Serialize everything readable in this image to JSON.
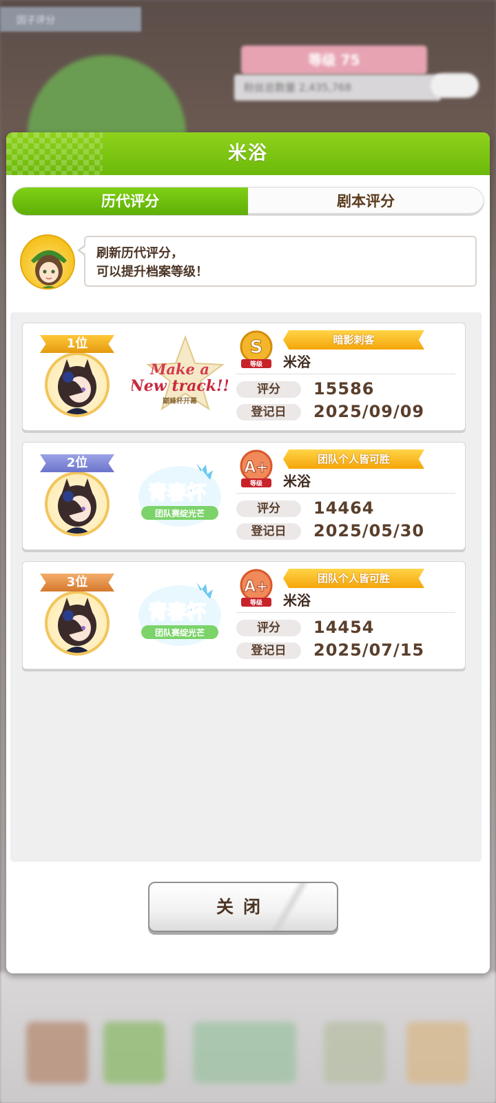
{
  "background": {
    "top_label": "因子评分",
    "level_text": "等级 75",
    "fans_text": "粉丝总数量 2,435,768"
  },
  "dialog": {
    "title": "米浴",
    "tabs": [
      {
        "label": "历代评分",
        "active": true
      },
      {
        "label": "剧本评分",
        "active": false
      }
    ],
    "hint_line1": "刷新历代评分，",
    "hint_line2": "可以提升档案等级！",
    "records": [
      {
        "rank": "1位",
        "grade": "S",
        "grade_sub": "等级",
        "title": "暗影刺客",
        "name": "米浴",
        "score_label": "评分",
        "score": "15586",
        "date_label": "登记日",
        "date": "2025/09/09",
        "scenario_line1": "Make a",
        "scenario_line2": "New track!!",
        "scenario_sub": "巅峰杯开幕"
      },
      {
        "rank": "2位",
        "grade": "A+",
        "grade_sub": "等级",
        "title": "团队个人皆可胜",
        "name": "米浴",
        "score_label": "评分",
        "score": "14464",
        "date_label": "登记日",
        "date": "2025/05/30",
        "scenario_line1": "青春杯",
        "scenario_sub": "团队赛绽光芒"
      },
      {
        "rank": "3位",
        "grade": "A+",
        "grade_sub": "等级",
        "title": "团队个人皆可胜",
        "name": "米浴",
        "score_label": "评分",
        "score": "14454",
        "date_label": "登记日",
        "date": "2025/07/15",
        "scenario_line1": "青春杯",
        "scenario_sub": "团队赛绽光芒"
      }
    ],
    "close_label": "关闭"
  },
  "colors": {
    "header_green": "#7cc815",
    "tab_active": "#6cbd0d",
    "rank1": "#f2b21f",
    "rank2": "#8089d6",
    "rank3": "#e58f45",
    "title_banner": "#f8b418",
    "text_brown": "#5a3f2c"
  }
}
